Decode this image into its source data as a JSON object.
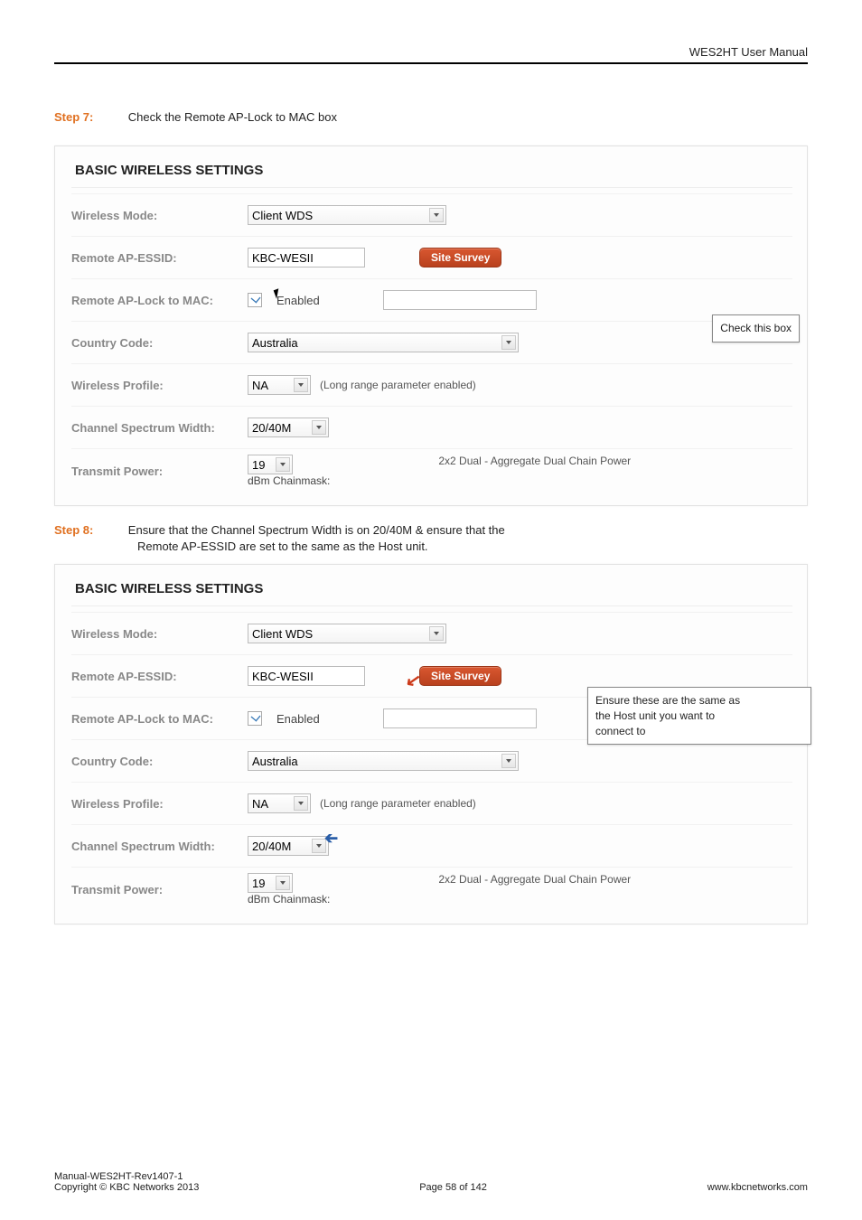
{
  "header": {
    "product": "WES2HT User Manual"
  },
  "step7": {
    "label": "Step 7:",
    "text": "Check the Remote AP-Lock to MAC box"
  },
  "step8": {
    "label": "Step 8:",
    "line1": "Ensure that the Channel Spectrum Width is on 20/40M & ensure that the",
    "line2": "Remote AP-ESSID are set to the same as the Host unit."
  },
  "panel1": {
    "title": "BASIC WIRELESS SETTINGS",
    "rows": {
      "wireless_mode": {
        "label": "Wireless Mode:",
        "value": "Client WDS"
      },
      "remote_essid": {
        "label": "Remote AP-ESSID:",
        "value": "KBC-WESII",
        "button": "Site Survey"
      },
      "lock_mac": {
        "label": "Remote AP-Lock to MAC:",
        "chk_label": "Enabled",
        "mac_value": ""
      },
      "country": {
        "label": "Country Code:",
        "value": "Australia"
      },
      "profile": {
        "label": "Wireless Profile:",
        "value": "NA",
        "note": "(Long range parameter enabled)"
      },
      "width": {
        "label": "Channel Spectrum Width:",
        "value": "20/40M"
      },
      "power": {
        "label": "Transmit Power:",
        "value": "19",
        "dbm": "dBm Chainmask:",
        "right": "2x2 Dual - Aggregate Dual Chain Power"
      }
    },
    "callout": "Check this box"
  },
  "panel2": {
    "title": "BASIC WIRELESS SETTINGS",
    "rows": {
      "wireless_mode": {
        "label": "Wireless Mode:",
        "value": "Client WDS"
      },
      "remote_essid": {
        "label": "Remote AP-ESSID:",
        "value": "KBC-WESII",
        "button": "Site Survey"
      },
      "lock_mac": {
        "label": "Remote AP-Lock to MAC:",
        "chk_label": "Enabled",
        "mac_value": ""
      },
      "country": {
        "label": "Country Code:",
        "value": "Australia"
      },
      "profile": {
        "label": "Wireless Profile:",
        "value": "NA",
        "note": "(Long range parameter enabled)"
      },
      "width": {
        "label": "Channel Spectrum Width:",
        "value": "20/40M"
      },
      "power": {
        "label": "Transmit Power:",
        "value": "19",
        "dbm": "dBm Chainmask:",
        "right": "2x2 Dual - Aggregate Dual Chain Power"
      }
    },
    "callout_l1": "Ensure these are the same as",
    "callout_l2": "the Host unit you want to",
    "callout_l3": "connect to"
  },
  "footer": {
    "line1": "Manual-WES2HT-Rev1407-1",
    "line2": "Copyright © KBC Networks 2013",
    "center": "Page 58 of 142",
    "right": "www.kbcnetworks.com"
  }
}
